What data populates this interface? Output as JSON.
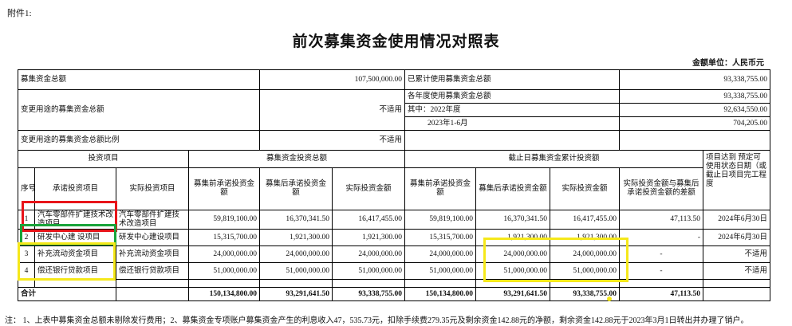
{
  "attachment": "附件1:",
  "title": "前次募集资金使用情况对照表",
  "unit": "金额单位：人民币元",
  "summary": {
    "total_label": "募集资金总额",
    "total_value": "107,500,000.00",
    "used_label": "已累计使用募集资金总额",
    "used_value": "93,338,755.00",
    "change_label": "变更用途的募集资金总额",
    "change_value": "不适用",
    "yearly_label": "各年度使用募集资金总额",
    "yearly_value": "93,338,755.00",
    "y2022_label": "其中：2022年度",
    "y2022_value": "92,634,550.00",
    "y2023_label": "2023年1-6月",
    "y2023_value": "704,205.00",
    "ratio_label": "变更用途的募集资金总额比例",
    "ratio_value": "不适用"
  },
  "headers": {
    "invest_project": "投资项目",
    "fund_total": "募集资金投资总额",
    "cumulative": "截止日募集资金累计投资额",
    "ready_date": "项目达到 预定可使用状态日期（或截止日项目完工程度",
    "seq": "序号",
    "promised": "承诺投资项目",
    "actual": "实际投资项目",
    "pre_promised": "募集前承诺投资金额",
    "post_promised": "募集后承诺投资金额",
    "actual_amount": "实际投资金额",
    "diff": "实际投资金额与募集后承诺投资金额的差额"
  },
  "rows": [
    {
      "seq": "1",
      "promised": "汽车零部件扩建技术改造项目",
      "actual": "汽车零部件扩建技术改造项目",
      "pre1": "59,819,100.00",
      "post1": "16,370,341.50",
      "act1": "16,417,455.00",
      "pre2": "59,819,100.00",
      "post2": "16,370,341.50",
      "act2": "16,417,455.00",
      "diff": "47,113.50",
      "date": "2024年6月30日"
    },
    {
      "seq": "2",
      "promised": "研发中心建 设项目",
      "actual": "研发中心建设项目",
      "pre1": "15,315,700.00",
      "post1": "1,921,300.00",
      "act1": "1,921,300.00",
      "pre2": "15,315,700.00",
      "post2": "1,921,300.00",
      "act2": "1,921,300.00",
      "diff": "-",
      "date": "2024年6月30日"
    },
    {
      "seq": "3",
      "promised": "补充流动资金项目",
      "actual": "补充流动资金项目",
      "pre1": "24,000,000.00",
      "post1": "24,000,000.00",
      "act1": "24,000,000.00",
      "pre2": "24,000,000.00",
      "post2": "24,000,000.00",
      "act2": "24,000,000.00",
      "diff": "-",
      "date": "不适用"
    },
    {
      "seq": "4",
      "promised": "偿还银行贷款项目",
      "actual": "偿还银行贷款项目",
      "pre1": "51,000,000.00",
      "post1": "51,000,000.00",
      "act1": "51,000,000.00",
      "pre2": "51,000,000.00",
      "post2": "51,000,000.00",
      "act2": "51,000,000.00",
      "diff": "-",
      "date": "不适用"
    }
  ],
  "total_row": {
    "label": "合计",
    "pre1": "150,134,800.00",
    "post1": "93,291,641.50",
    "act1": "93,338,755.00",
    "pre2": "150,134,800.00",
    "post2": "93,291,641.50",
    "act2": "93,338,755.00",
    "diff": "47,113.50"
  },
  "note": "注：   1、上表中募集资金总额未剔除发行费用；2、募集资金专项账户募集资金产生的利息收入47，535.73元，扣除手续费279.35元及剩余资金142.88元的净额，剩余资金142.88元于2023年3月1日转出并办理了销户。",
  "highlight_colors": {
    "red": "#e8141a",
    "green": "#1aa43a",
    "yellow": "#f5e81a"
  }
}
